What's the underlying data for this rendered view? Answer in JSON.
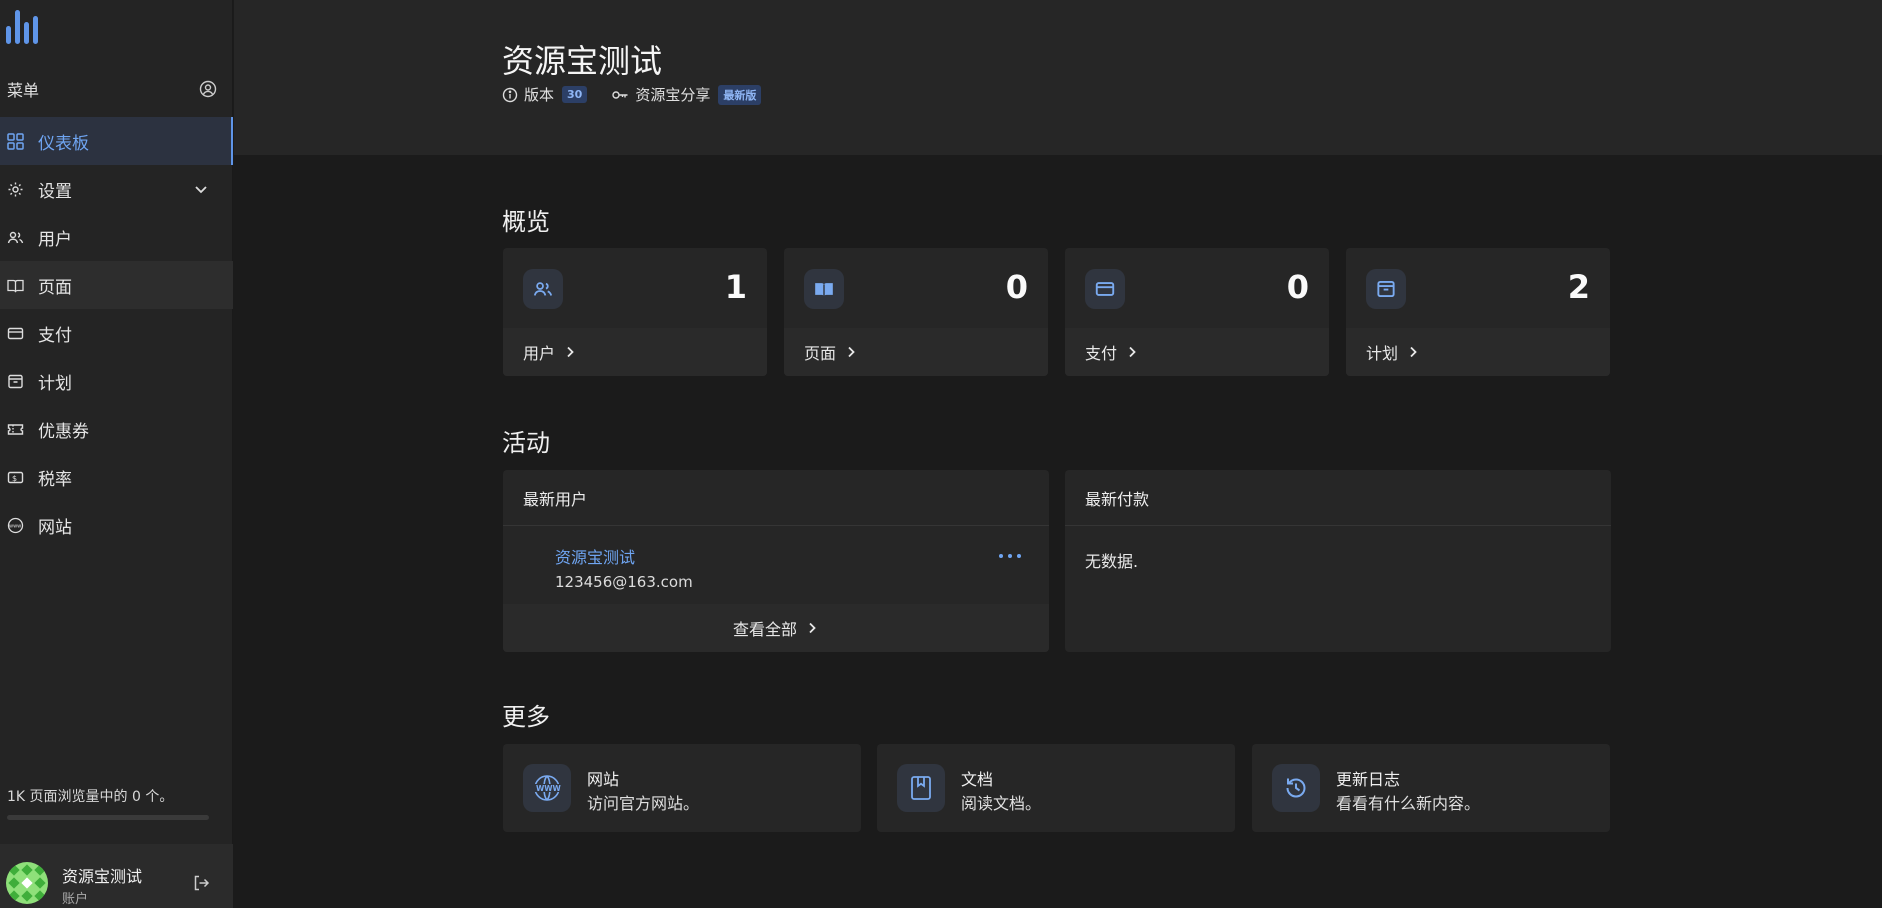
{
  "sidebar": {
    "menu_label": "菜单",
    "items": [
      {
        "label": "仪表板"
      },
      {
        "label": "设置"
      },
      {
        "label": "用户"
      },
      {
        "label": "页面"
      },
      {
        "label": "支付"
      },
      {
        "label": "计划"
      },
      {
        "label": "优惠券"
      },
      {
        "label": "税率"
      },
      {
        "label": "网站"
      }
    ],
    "usage_text": "1K 页面浏览量中的 0 个。",
    "usage_fraction": 0,
    "account": {
      "name": "资源宝测试",
      "subtitle": "账户"
    }
  },
  "header": {
    "title": "资源宝测试",
    "version_label": "版本",
    "version_value": "30",
    "license_label": "资源宝分享",
    "license_badge": "最新版"
  },
  "overview": {
    "title": "概览",
    "cards": [
      {
        "label": "用户",
        "value": "1",
        "icon": "users-icon"
      },
      {
        "label": "页面",
        "value": "0",
        "icon": "book-icon"
      },
      {
        "label": "支付",
        "value": "0",
        "icon": "credit-card-icon"
      },
      {
        "label": "计划",
        "value": "2",
        "icon": "box-icon"
      }
    ]
  },
  "activity": {
    "title": "活动",
    "latest_users": {
      "title": "最新用户",
      "user_name": "资源宝测试",
      "user_email": "123456@163.com",
      "view_all": "查看全部"
    },
    "latest_payments": {
      "title": "最新付款",
      "empty_text": "无数据."
    }
  },
  "more": {
    "title": "更多",
    "cards": [
      {
        "title": "网站",
        "subtitle": "访问官方网站。",
        "icon": "www-icon"
      },
      {
        "title": "文档",
        "subtitle": "阅读文档。",
        "icon": "document-icon"
      },
      {
        "title": "更新日志",
        "subtitle": "看看有什么新内容。",
        "icon": "history-icon"
      }
    ]
  },
  "colors": {
    "accent": "#6fa5f2",
    "sidebar_bg": "#242424",
    "main_bg": "#1b1b1b",
    "card_bg": "#262626"
  }
}
